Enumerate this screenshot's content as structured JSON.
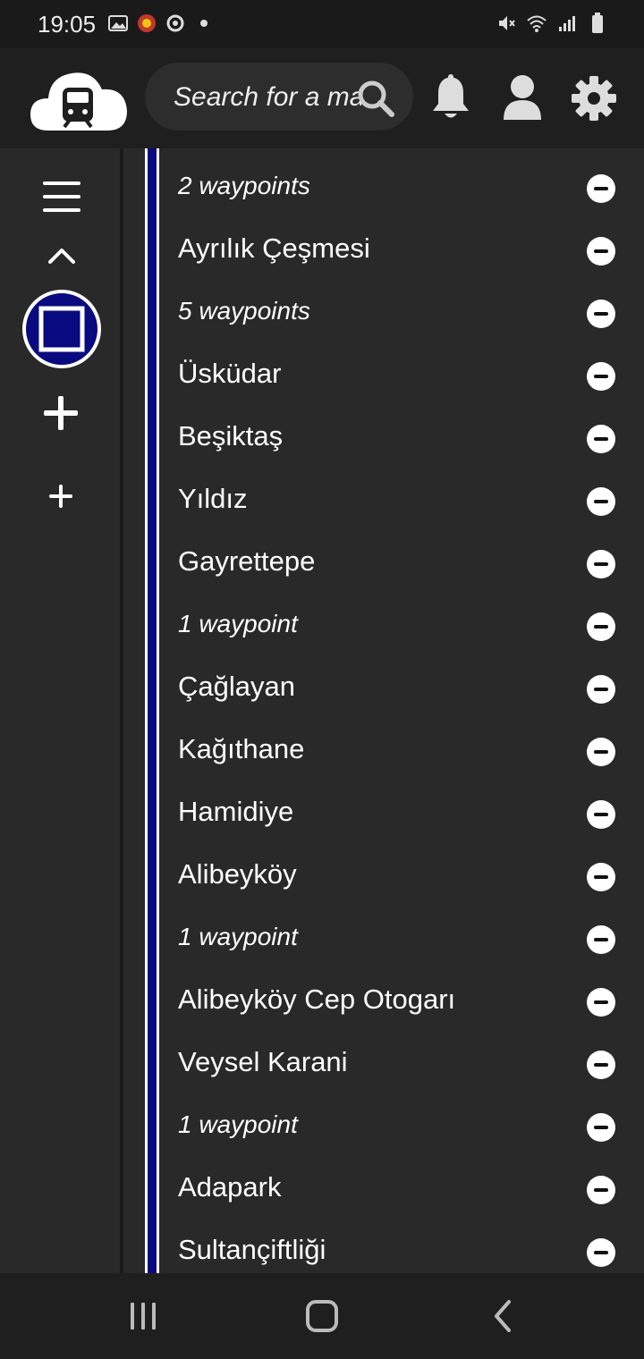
{
  "status_bar": {
    "time": "19:05",
    "left_icons": [
      "gallery-icon",
      "app-notification-icon",
      "sync-icon",
      "dot-icon"
    ],
    "right_icons": [
      "mute-icon",
      "wifi-icon",
      "signal-icon",
      "battery-icon"
    ]
  },
  "header": {
    "logo": "train-cloud-logo",
    "search": {
      "placeholder": "Search for a ma"
    },
    "icons": [
      "search-icon",
      "bell-icon",
      "user-icon",
      "gear-icon"
    ]
  },
  "sidebar": {
    "icons": [
      "menu-icon",
      "chevron-up-icon",
      "square-stop-icon",
      "plus-icon",
      "plus-small-icon"
    ],
    "accent_color": "#0a0a80"
  },
  "route": {
    "line_color": "#0a0a80",
    "items": [
      {
        "label": "2 waypoints",
        "type": "waypoints"
      },
      {
        "label": "Ayrılık Çeşmesi",
        "type": "station"
      },
      {
        "label": "5 waypoints",
        "type": "waypoints"
      },
      {
        "label": "Üsküdar",
        "type": "station"
      },
      {
        "label": "Beşiktaş",
        "type": "station"
      },
      {
        "label": "Yıldız",
        "type": "station"
      },
      {
        "label": "Gayrettepe",
        "type": "station"
      },
      {
        "label": "1 waypoint",
        "type": "waypoints"
      },
      {
        "label": "Çağlayan",
        "type": "station"
      },
      {
        "label": "Kağıthane",
        "type": "station"
      },
      {
        "label": "Hamidiye",
        "type": "station"
      },
      {
        "label": "Alibeyköy",
        "type": "station"
      },
      {
        "label": "1 waypoint",
        "type": "waypoints"
      },
      {
        "label": "Alibeyköy Cep Otogarı",
        "type": "station"
      },
      {
        "label": "Veysel Karani",
        "type": "station"
      },
      {
        "label": "1 waypoint",
        "type": "waypoints"
      },
      {
        "label": "Adapark",
        "type": "station"
      },
      {
        "label": "Sultançiftliği",
        "type": "station"
      }
    ]
  },
  "nav_bar": {
    "icons": [
      "recent-apps-icon",
      "home-icon",
      "back-icon"
    ]
  }
}
